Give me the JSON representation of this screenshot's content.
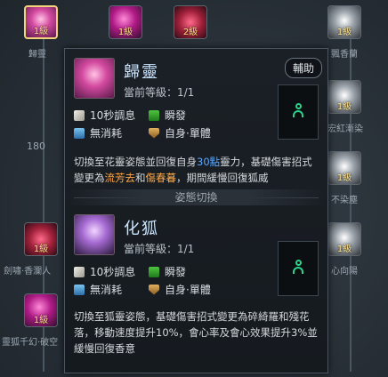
{
  "background": {
    "nodes": [
      {
        "label": "1級",
        "name": "歸靈",
        "style": "pink",
        "selected": true
      },
      {
        "label": "1級",
        "name": "",
        "style": "magenta",
        "selected": false
      },
      {
        "label": "2級",
        "name": "",
        "style": "red",
        "selected": false
      },
      {
        "label": "1級",
        "name": "飄香蘭",
        "style": "silver",
        "selected": false
      },
      {
        "label": "1級",
        "name": "宏紅漸染",
        "style": "silver",
        "selected": false
      },
      {
        "label": "1級",
        "name": "不染塵",
        "style": "silver",
        "selected": false
      },
      {
        "label": "1級",
        "name": "劍嘯·香瀾人",
        "style": "red",
        "selected": false
      },
      {
        "label": "1級",
        "name": "心向陽",
        "style": "silver",
        "selected": false
      },
      {
        "label": "1級",
        "name": "靈狐千幻·破空",
        "style": "magenta",
        "selected": false
      }
    ],
    "side_number": "180"
  },
  "tooltip": {
    "skill1": {
      "name": "歸靈",
      "level_text": "當前等級：1/1",
      "tag": "輔助",
      "cooldown": "10秒調息",
      "cast": "瞬發",
      "cost": "無消耗",
      "target": "自身·單體",
      "desc": {
        "p1": "切換至花靈姿態並回復自身",
        "v1": "30點",
        "p2": "靈力，基礎傷害招式變更為",
        "v2": "流芳去",
        "p3": "和",
        "v3": "傷春暮",
        "p4": "，期間緩慢回復狐威"
      }
    },
    "divider": "姿態切換",
    "skill2": {
      "name": "化狐",
      "level_text": "當前等級：1/1",
      "cooldown": "10秒調息",
      "cast": "瞬發",
      "cost": "無消耗",
      "target": "自身·單體",
      "desc": "切換至狐靈姿態，基礎傷害招式變更為碎綺羅和殘花落，移動速度提升10%，會心率及會心效果提升3%並緩慢回復香意"
    }
  },
  "colors": {
    "highlight_blue": "#5aa8ff",
    "highlight_orange": "#ffa94a",
    "support_green": "#2fd38a"
  }
}
